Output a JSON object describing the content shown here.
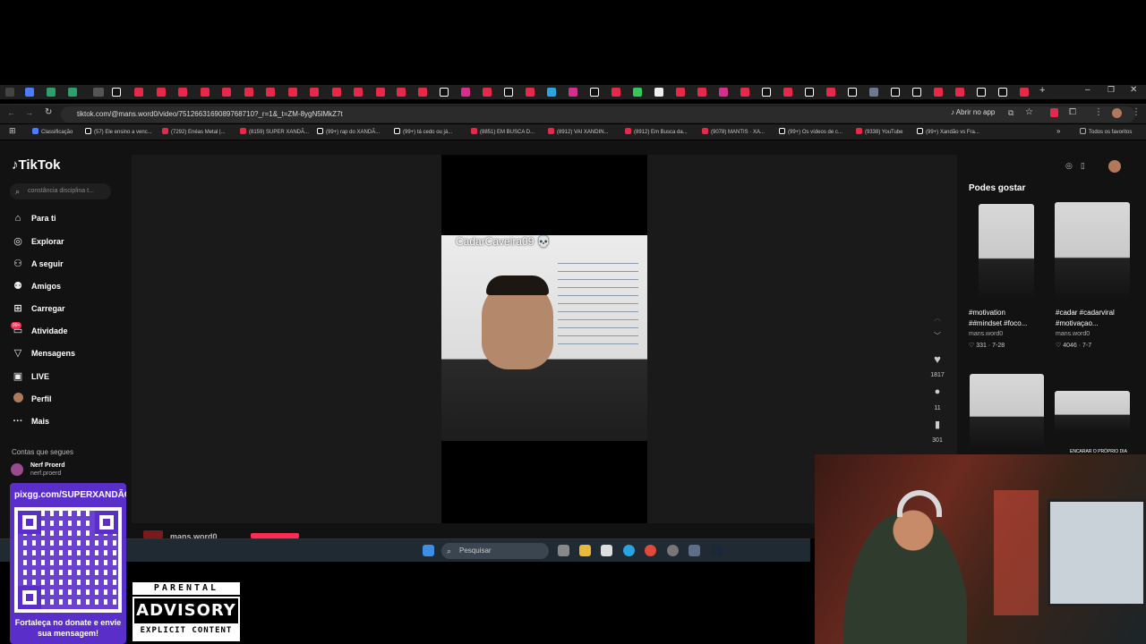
{
  "browser": {
    "url": "tiktok.com/@mans.word0/video/7512663169089768710?_r=1&_t=ZM-8ygN5lMkZ7t",
    "open_in_app": "Abrir no app",
    "all_favorites": "Todos os favoritos",
    "bookmarks": [
      "Classificação",
      "(57) Ele ensino a venc...",
      "(7292) Enéas Metal |...",
      "(8159) SUPER XANDÃ...",
      "(99+) rap do XANDÃ...",
      "(99+) tá cedo ou já...",
      "(8851) EM BUSCA D...",
      "(8912) VAI XANDIN...",
      "(8912) Em Busca da...",
      "(9078) MANTIS · XA...",
      "(99+) Os vídeos de c...",
      "(9338) YouTube",
      "(99+) Xandão vs Fra..."
    ]
  },
  "tiktok": {
    "logo": "TikTok",
    "search_placeholder": "constância disciplina t...",
    "nav": [
      {
        "label": "Para ti",
        "icon": "home-icon"
      },
      {
        "label": "Explorar",
        "icon": "compass-icon"
      },
      {
        "label": "A seguir",
        "icon": "user-plus-icon"
      },
      {
        "label": "Amigos",
        "icon": "users-icon"
      },
      {
        "label": "Carregar",
        "icon": "plus-square-icon"
      },
      {
        "label": "Atividade",
        "icon": "inbox-icon",
        "badge": "99+"
      },
      {
        "label": "Mensagens",
        "icon": "send-icon"
      },
      {
        "label": "LIVE",
        "icon": "live-icon"
      },
      {
        "label": "Perfil",
        "icon": "avatar"
      },
      {
        "label": "Mais",
        "icon": "more-icon"
      }
    ],
    "following_heading": "Contas que segues",
    "following_user": {
      "name": "Nerf Proerd",
      "handle": "nerf.proerd"
    },
    "video_caption": "CadarCaveira09 💀",
    "author": "mans.word0",
    "actions": {
      "likes": "1817",
      "comments": "11",
      "saves": "301"
    },
    "recommended_heading": "Podes gostar",
    "recommended": [
      {
        "title": "#motivation ##mindset #foco...",
        "author": "mans.word0",
        "stats": "♡ 331 · 7-28"
      },
      {
        "title": "#cadar #cadarviral #motivaçao...",
        "author": "mans.word0",
        "stats": "♡ 4046 · 7-7"
      }
    ],
    "thumb_overlay": "ENCARAR O PRÓPRIO DIA"
  },
  "taskbar": {
    "search_placeholder": "Pesquisar"
  },
  "overlay": {
    "donate_url": "pixgg.com/SUPERXANDÃO",
    "donate_message": "Fortaleça no donate e envie sua mensagem!",
    "advisory_top": "PARENTAL",
    "advisory_mid": "ADVISORY",
    "advisory_bottom": "EXPLICIT CONTENT"
  }
}
